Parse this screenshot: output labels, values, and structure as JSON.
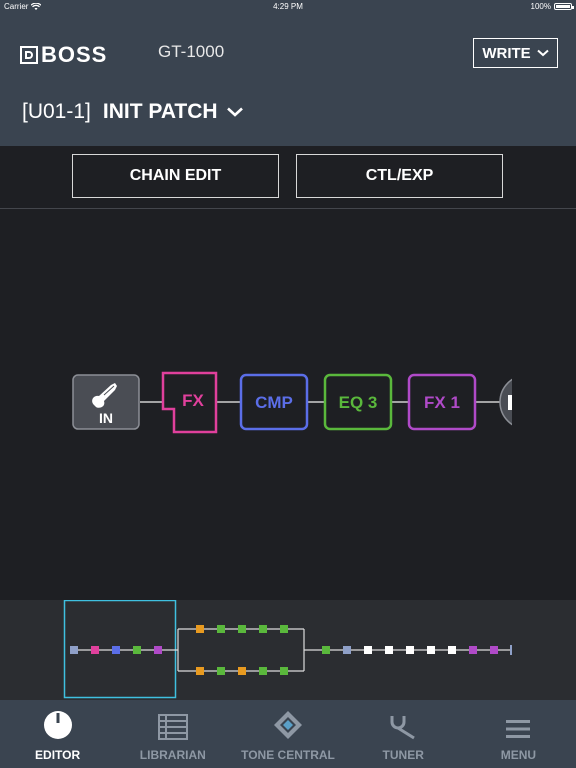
{
  "status_bar": {
    "carrier": "Carrier",
    "time": "4:29 PM",
    "battery": "100%"
  },
  "header": {
    "brand": "BOSS",
    "model": "GT-1000",
    "write_label": "WRITE",
    "patch_number": "[U01-1]",
    "patch_name": "INIT PATCH"
  },
  "edit_buttons": {
    "chain_edit": "CHAIN EDIT",
    "ctl_exp": "CTL/EXP"
  },
  "chain": {
    "blocks": [
      {
        "id": "in",
        "label": "IN",
        "color": "#8c8f96"
      },
      {
        "id": "fx",
        "label": "FX",
        "color": "#e0409c"
      },
      {
        "id": "cmp",
        "label": "CMP",
        "color": "#5b6ee8"
      },
      {
        "id": "eq3",
        "label": "EQ 3",
        "color": "#5ab83c"
      },
      {
        "id": "fx1",
        "label": "FX 1",
        "color": "#b04ac8"
      }
    ]
  },
  "tabs": [
    {
      "label": "EDITOR",
      "icon": "knob-icon",
      "active": true
    },
    {
      "label": "LIBRARIAN",
      "icon": "list-icon",
      "active": false
    },
    {
      "label": "TONE CENTRAL",
      "icon": "tone-central-icon",
      "active": false
    },
    {
      "label": "TUNER",
      "icon": "tuning-fork-icon",
      "active": false
    },
    {
      "label": "MENU",
      "icon": "hamburger-icon",
      "active": false
    }
  ],
  "colors": {
    "header_bg": "#3a4450",
    "body_bg": "#1e1f23",
    "overview_highlight": "#3fc0e0"
  }
}
